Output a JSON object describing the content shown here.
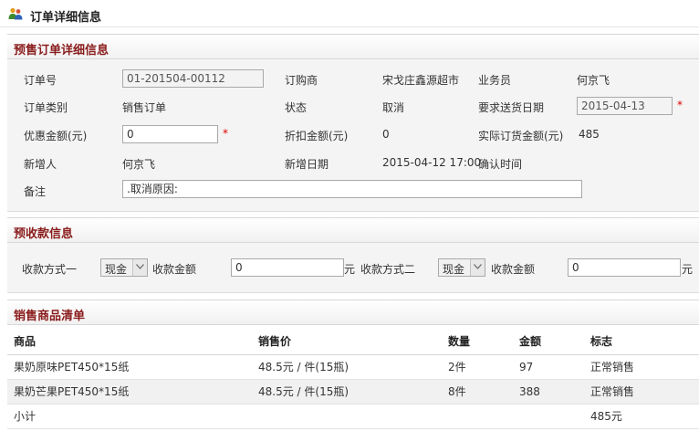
{
  "page": {
    "title": "订单详细信息",
    "icon": "users-icon"
  },
  "order_section": {
    "title": "预售订单详细信息",
    "fields": {
      "order_no_label": "订单号",
      "order_no_value": "01-201504-00112",
      "buyer_label": "订购商",
      "buyer_value": "宋戈庄鑫源超市",
      "salesman_label": "业务员",
      "salesman_value": "何京飞",
      "order_type_label": "订单类别",
      "order_type_value": "销售订单",
      "status_label": "状态",
      "status_value": "取消",
      "delivery_date_label": "要求送货日期",
      "delivery_date_value": "2015-04-13",
      "discount_label": "优惠金额(元)",
      "discount_value": "0",
      "rebate_label": "折扣金额(元)",
      "rebate_value": "0",
      "actual_label": "实际订货金额(元)",
      "actual_value": "485",
      "creator_label": "新增人",
      "creator_value": "何京飞",
      "created_date_label": "新增日期",
      "created_date_value": "2015-04-12 17:00",
      "confirm_time_label": "确认时间",
      "remark_label": "备注",
      "remark_value": ".取消原因:",
      "required_mark": "*"
    }
  },
  "payment_section": {
    "title": "预收款信息",
    "method1_label": "收款方式一",
    "method1_value": "现金",
    "amount1_label": "收款金额",
    "amount1_value": "0",
    "unit1": "元",
    "method2_label": "收款方式二",
    "method2_value": "现金",
    "amount2_label": "收款金额",
    "amount2_value": "0",
    "unit2": "元"
  },
  "goods_section": {
    "title": "销售商品清单",
    "columns": [
      "商品",
      "销售价",
      "数量",
      "金额",
      "标志"
    ],
    "rows": [
      {
        "product": "果奶原味PET450*15纸",
        "price": "48.5元 / 件(15瓶)",
        "qty": "2件",
        "amount": "97",
        "flag": "正常销售"
      },
      {
        "product": "果奶芒果PET450*15纸",
        "price": "48.5元 / 件(15瓶)",
        "qty": "8件",
        "amount": "388",
        "flag": "正常销售"
      }
    ],
    "subtotal_label": "小计",
    "subtotal_value": "485元"
  },
  "colors": {
    "section_title": "#8a1c1c",
    "required": "#dd0000",
    "total": "#d00000"
  }
}
